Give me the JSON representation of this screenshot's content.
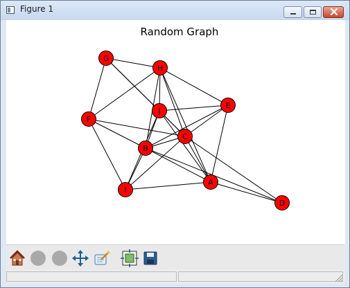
{
  "window": {
    "title": "Figure 1"
  },
  "figure": {
    "title": "Random Graph"
  },
  "graph": {
    "node_color": "#ff0000",
    "edge_color": "#000000",
    "nodes": [
      {
        "id": "A"
      },
      {
        "id": "B"
      },
      {
        "id": "C"
      },
      {
        "id": "D"
      },
      {
        "id": "E"
      },
      {
        "id": "F"
      },
      {
        "id": "G"
      },
      {
        "id": "H"
      },
      {
        "id": "I"
      },
      {
        "id": "J"
      }
    ],
    "edges": [
      [
        "G",
        "H"
      ],
      [
        "G",
        "F"
      ],
      [
        "G",
        "J"
      ],
      [
        "G",
        "C"
      ],
      [
        "H",
        "J"
      ],
      [
        "H",
        "B"
      ],
      [
        "H",
        "C"
      ],
      [
        "H",
        "E"
      ],
      [
        "H",
        "F"
      ],
      [
        "H",
        "A"
      ],
      [
        "J",
        "E"
      ],
      [
        "J",
        "B"
      ],
      [
        "J",
        "I"
      ],
      [
        "J",
        "C"
      ],
      [
        "J",
        "A"
      ],
      [
        "E",
        "C"
      ],
      [
        "E",
        "B"
      ],
      [
        "E",
        "A"
      ],
      [
        "F",
        "C"
      ],
      [
        "F",
        "B"
      ],
      [
        "F",
        "I"
      ],
      [
        "C",
        "B"
      ],
      [
        "C",
        "I"
      ],
      [
        "C",
        "A"
      ],
      [
        "C",
        "D"
      ],
      [
        "B",
        "I"
      ],
      [
        "B",
        "A"
      ],
      [
        "B",
        "D"
      ],
      [
        "I",
        "A"
      ],
      [
        "A",
        "D"
      ]
    ]
  },
  "toolbar": {
    "buttons": [
      {
        "name": "home-button",
        "icon": "home-icon"
      },
      {
        "name": "back-button",
        "icon": "back-icon"
      },
      {
        "name": "forward-button",
        "icon": "forward-icon"
      },
      {
        "name": "pan-button",
        "icon": "pan-icon"
      },
      {
        "name": "zoom-button",
        "icon": "zoom-icon"
      },
      {
        "name": "subplots-button",
        "icon": "subplots-icon"
      },
      {
        "name": "save-button",
        "icon": "save-icon"
      }
    ]
  },
  "status": {
    "message": ""
  }
}
